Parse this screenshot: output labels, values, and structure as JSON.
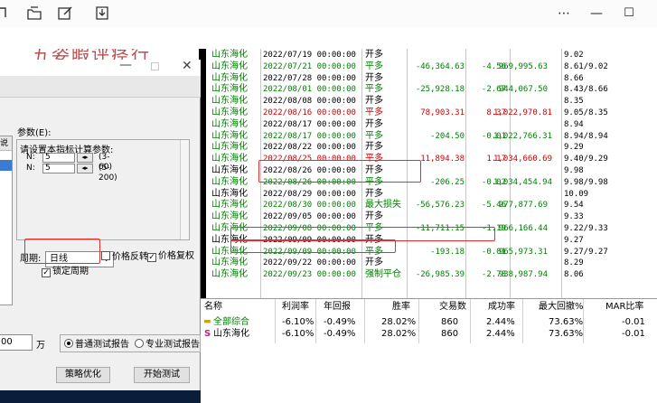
{
  "toolbar": {
    "more_icon": "more-dots-icon",
    "minimize": "—",
    "maximize": "☐"
  },
  "banner_text": "五姿暇评痉行",
  "trades": [
    {
      "name": "山东海化",
      "date": "2022/07/19 00:00:00",
      "action": "开多",
      "pnl": "",
      "pct": "",
      "capital": "",
      "info": "9.02",
      "date_color": "#000000",
      "action_color": "#000000",
      "name_color": "#008000",
      "pnl_color": "#000000"
    },
    {
      "name": "山东海化",
      "date": "2022/07/21 00:00:00",
      "action": "平多",
      "pnl": "-46,364.63",
      "pct": "-4.56",
      "capital": "969,995.63",
      "info": "8.61/9.02",
      "date_color": "#008000",
      "action_color": "#008000",
      "name_color": "#008000",
      "pnl_color": "#008000"
    },
    {
      "name": "山东海化",
      "date": "2022/07/28 00:00:00",
      "action": "开多",
      "pnl": "",
      "pct": "",
      "capital": "",
      "info": "8.66",
      "date_color": "#000000",
      "action_color": "#000000",
      "name_color": "#008000",
      "pnl_color": "#000000"
    },
    {
      "name": "山东海化",
      "date": "2022/08/01 00:00:00",
      "action": "平多",
      "pnl": "-25,928.18",
      "pct": "-2.67",
      "capital": "944,067.50",
      "info": "8.43/8.66",
      "date_color": "#008000",
      "action_color": "#008000",
      "name_color": "#008000",
      "pnl_color": "#008000"
    },
    {
      "name": "山东海化",
      "date": "2022/08/08 00:00:00",
      "action": "开多",
      "pnl": "",
      "pct": "",
      "capital": "",
      "info": "8.35",
      "date_color": "#000000",
      "action_color": "#000000",
      "name_color": "#008000",
      "pnl_color": "#000000"
    },
    {
      "name": "山东海化",
      "date": "2022/08/16 00:00:00",
      "action": "平多",
      "pnl": "78,903.31",
      "pct": "8.37",
      "capital": "1,022,970.81",
      "info": "9.05/8.35",
      "date_color": "#d00000",
      "action_color": "#d00000",
      "name_color": "#008000",
      "pnl_color": "#d00000"
    },
    {
      "name": "山东海化",
      "date": "2022/08/17 00:00:00",
      "action": "开多",
      "pnl": "",
      "pct": "",
      "capital": "",
      "info": "8.94",
      "date_color": "#000000",
      "action_color": "#000000",
      "name_color": "#008000",
      "pnl_color": "#000000"
    },
    {
      "name": "山东海化",
      "date": "2022/08/17 00:00:00",
      "action": "平多",
      "pnl": "-204.50",
      "pct": "-0.01",
      "capital": "1,022,766.31",
      "info": "8.94/8.94",
      "date_color": "#008000",
      "action_color": "#008000",
      "name_color": "#008000",
      "pnl_color": "#008000"
    },
    {
      "name": "山东海化",
      "date": "2022/08/22 00:00:00",
      "action": "开多",
      "pnl": "",
      "pct": "",
      "capital": "",
      "info": "9.29",
      "date_color": "#000000",
      "action_color": "#000000",
      "name_color": "#008000",
      "pnl_color": "#000000"
    },
    {
      "name": "山东海化",
      "date": "2022/08/25 00:00:00",
      "action": "平多",
      "pnl": "11,894.38",
      "pct": "1.17",
      "capital": "1,034,660.69",
      "info": "9.40/9.29",
      "date_color": "#d00000",
      "action_color": "#d00000",
      "name_color": "#008000",
      "pnl_color": "#d00000"
    },
    {
      "name": "山东海化",
      "date": "2022/08/26 00:00:00",
      "action": "开多",
      "pnl": "",
      "pct": "",
      "capital": "",
      "info": "9.98",
      "date_color": "#000000",
      "action_color": "#000000",
      "name_color": "#000000",
      "pnl_color": "#000000"
    },
    {
      "name": "山东海化",
      "date": "2022/08/26 00:00:00",
      "action": "平多",
      "pnl": "-206.25",
      "pct": "-0.02",
      "capital": "1,034,454.94",
      "info": "9.98/9.98",
      "date_color": "#008000",
      "action_color": "#008000",
      "name_color": "#008000",
      "pnl_color": "#008000"
    },
    {
      "name": "山东海化",
      "date": "2022/08/29 00:00:00",
      "action": "开多",
      "pnl": "",
      "pct": "",
      "capital": "",
      "info": "10.09",
      "date_color": "#000000",
      "action_color": "#000000",
      "name_color": "#000000",
      "pnl_color": "#000000"
    },
    {
      "name": "山东海化",
      "date": "2022/08/30 00:00:00",
      "action": "最大损失",
      "pnl": "-56,576.23",
      "pct": "-5.46",
      "capital": "977,877.69",
      "info": "9.54",
      "date_color": "#008000",
      "action_color": "#008000",
      "name_color": "#008000",
      "pnl_color": "#008000"
    },
    {
      "name": "山东海化",
      "date": "2022/09/05 00:00:00",
      "action": "开多",
      "pnl": "",
      "pct": "",
      "capital": "",
      "info": "9.33",
      "date_color": "#000000",
      "action_color": "#000000",
      "name_color": "#008000",
      "pnl_color": "#000000"
    },
    {
      "name": "山东海化",
      "date": "2022/09/08 00:00:00",
      "action": "平多",
      "pnl": "-11,711.15",
      "pct": "-1.19",
      "capital": "966,166.44",
      "info": "9.22/9.33",
      "date_color": "#008000",
      "action_color": "#008000",
      "name_color": "#008000",
      "pnl_color": "#008000"
    },
    {
      "name": "山东海化",
      "date": "2022/09/09 00:00:00",
      "action": "开多",
      "pnl": "",
      "pct": "",
      "capital": "",
      "info": "9.27",
      "date_color": "#000000",
      "action_color": "#000000",
      "name_color": "#000000",
      "pnl_color": "#000000"
    },
    {
      "name": "山东海化",
      "date": "2022/09/09 00:00:00",
      "action": "平多",
      "pnl": "-193.18",
      "pct": "-0.01",
      "capital": "965,973.31",
      "info": "9.27/9.27",
      "date_color": "#008000",
      "action_color": "#008000",
      "name_color": "#008000",
      "pnl_color": "#008000"
    },
    {
      "name": "山东海化",
      "date": "2022/09/22 00:00:00",
      "action": "开多",
      "pnl": "",
      "pct": "",
      "capital": "",
      "info": "8.29",
      "date_color": "#000000",
      "action_color": "#000000",
      "name_color": "#008000",
      "pnl_color": "#000000"
    },
    {
      "name": "山东海化",
      "date": "2022/09/23 00:00:00",
      "action": "强制平仓",
      "pnl": "-26,985.39",
      "pct": "-2.78",
      "capital": "938,987.94",
      "info": "8.06",
      "date_color": "#008000",
      "action_color": "#008000",
      "name_color": "#008000",
      "pnl_color": "#008000"
    }
  ],
  "stats": {
    "headers": [
      "名称",
      "利润率",
      "年回报",
      "胜率",
      "交易数",
      "成功率",
      "最大回撤%",
      "MAR比率"
    ],
    "rows": [
      {
        "icon": "folder-icon",
        "name": "全部综合",
        "values": [
          "-6.10%",
          "-0.49%",
          "28.02%",
          "860",
          "2.44%",
          "73.63%",
          "-0.01"
        ],
        "name_color": "#008000"
      },
      {
        "icon": "s-marker-icon",
        "name": "山东海化",
        "values": [
          "-6.10%",
          "-0.49%",
          "28.02%",
          "860",
          "2.44%",
          "73.63%",
          "-0.01"
        ],
        "name_color": "#000000"
      }
    ]
  },
  "dialog": {
    "strip_label": "",
    "params_label": "参数(E):",
    "left_header": "说",
    "params_title": "请设置本指标计算参数:",
    "params": [
      {
        "label": "N:",
        "value": "5",
        "range": "(3-60)"
      },
      {
        "label": "N:",
        "value": "5",
        "range": "(5-200)"
      }
    ],
    "period_label": "周期:",
    "period_value": "日线",
    "checkbox_reverse": "价格反转",
    "checkbox_restore": "价格复权",
    "checkbox_lock": "锁定周期",
    "capital_value": "00",
    "capital_unit": "万",
    "radio_normal": "普通测试报告",
    "radio_pro": "专业测试报告",
    "btn_optimize": "策略优化",
    "btn_start": "开始测试"
  }
}
